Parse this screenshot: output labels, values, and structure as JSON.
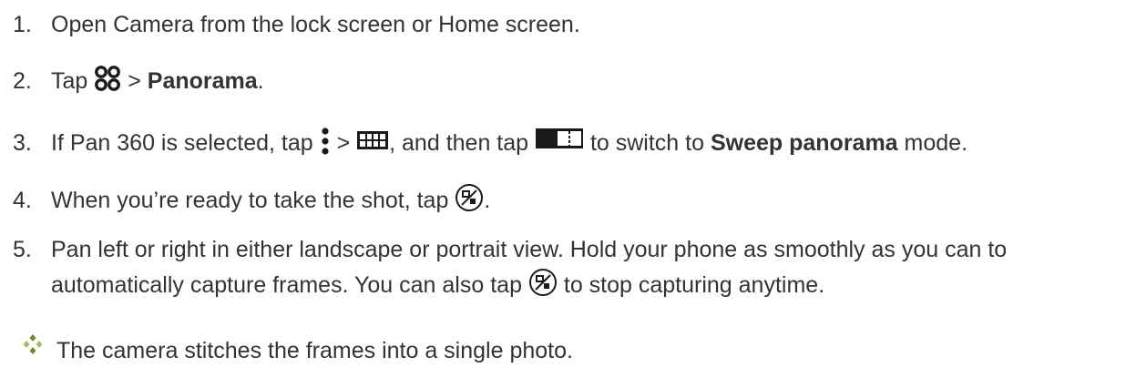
{
  "steps": [
    {
      "num": "1.",
      "text": "Open Camera from the lock screen or Home screen."
    },
    {
      "num": "2.",
      "pre": "Tap",
      "mid": " > ",
      "bold": "Panorama",
      "post": "."
    },
    {
      "num": "3.",
      "pre": "If Pan 360 is selected, tap",
      "mid1": " > ",
      "mid2": ", and then tap",
      "mid3": " to switch to ",
      "bold": "Sweep panorama",
      "post": " mode."
    },
    {
      "num": "4.",
      "pre": "When you’re ready to take the shot, tap",
      "post": "."
    },
    {
      "num": "5.",
      "line1": "Pan left or right in either landscape or portrait view. Hold your phone as smoothly as you can to",
      "line2_pre": "automatically capture frames. You can also tap",
      "line2_post": " to stop capturing anytime."
    }
  ],
  "result": "The camera stitches the frames into a single photo.",
  "icons": {
    "modes": "modes-icon",
    "menu": "more-vert-icon",
    "pan": "panorama-mode-icon",
    "sweep": "sweep-toggle-icon",
    "shutter": "panorama-shutter-icon",
    "bullet": "diamond-bullet-icon"
  }
}
